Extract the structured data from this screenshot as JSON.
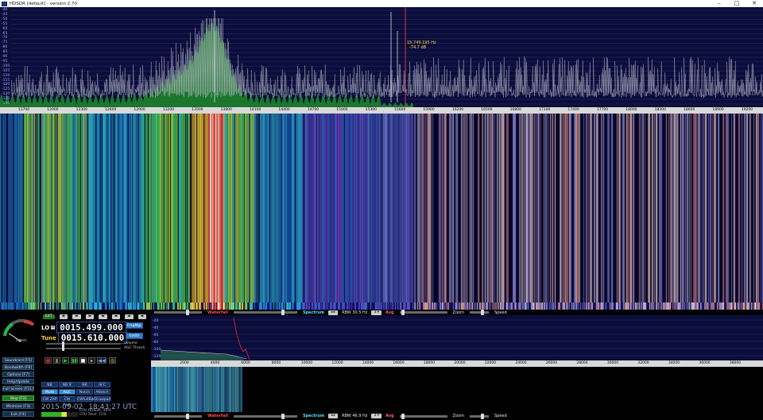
{
  "window": {
    "title": "HDSDR [default] - version 2.70",
    "minimize": "–",
    "maximize": "□",
    "close": "✕"
  },
  "spectrum": {
    "db_labels": [
      "-40",
      "-45",
      "-50",
      "-55",
      "-60",
      "-65",
      "-70",
      "-75",
      "-80",
      "-85",
      "-90",
      "-95",
      "-100",
      "-105",
      "-110",
      "-115",
      "-120",
      "-125",
      "-130",
      "-135",
      "-140"
    ],
    "marker_freq": "15.749.195 Hz",
    "marker_level": "-74.7 dB",
    "axis_ticks": [
      "11700",
      "12000",
      "12300",
      "12600",
      "12900",
      "13200",
      "13500",
      "13800",
      "14100",
      "14400",
      "14700",
      "15000",
      "15300",
      "15600",
      "15900",
      "16200",
      "16500",
      "16800",
      "17100",
      "17400",
      "17700",
      "18000",
      "18300",
      "18600",
      "18900",
      "19200"
    ]
  },
  "strip_top": {
    "waterfall_label": "Waterfall",
    "spectrum_label": "Spectrum",
    "rbw_label": "RBW 30.5 Hz",
    "avg_label": "Avg",
    "zoom_label": "Zoom",
    "speed_label": "Speed"
  },
  "strip_bottom": {
    "waterfall_label": "Waterfall",
    "spectrum_label": "Spectrum",
    "rbw_label": "RBW 46.9 Hz",
    "avg_label": "Avg",
    "zoom_label": "Zoom",
    "speed_label": "Speed"
  },
  "left": {
    "smeter_label": "S-units",
    "buttons": [
      "Soundcard [F5]",
      "Bandwidth [F6]",
      "Options  [F7]",
      "Help/Update [F1]",
      "Full Screen [F11]",
      "Stop     [F2]",
      "Minimize  [F3]",
      "Exit     [F4]"
    ],
    "lo_label": "LO",
    "lo_sub": "A",
    "lo_freq": "0015.499.000",
    "tune_label": "Tune",
    "tune_freq": "0015.610.000",
    "freqmgr": "FreqMgr",
    "extio": "ExtIO",
    "volume": "Volume",
    "agc_thresh": "AGC Thresh.",
    "mode_row1": [
      "NB",
      "NB IF",
      "NR",
      "AFC"
    ],
    "mode_row2": [
      "Mute",
      "AGC Fast",
      "Notch",
      "ANotch"
    ],
    "mode_row3": [
      "CW ZAP",
      "CW Peak",
      "CWfullBw",
      "Drawpad"
    ],
    "date": "2015-09-02",
    "time": "18:43:27 UTC",
    "cpu1_label": "CPU",
    "cpu1_value": "HDSDR: 44%",
    "cpu2_label": "CPU",
    "cpu2_value": "Total: 72%"
  },
  "audio": {
    "db_labels": [
      "-20",
      "-40",
      "-60",
      "-80",
      "-100",
      "-120"
    ],
    "axis_ticks": [
      "2000",
      "4000",
      "6000",
      "8000",
      "10000",
      "12000",
      "14000",
      "16000",
      "18000",
      "20000",
      "22000",
      "24000",
      "26000",
      "28000",
      "30000",
      "32000",
      "34000",
      "36000",
      "38000"
    ]
  },
  "colors": {
    "background": "#0b0d3a",
    "spectrum_trace": "#b8bcc8",
    "spectrum_fill": "#1f8a2a",
    "marker_line": "#d23b3b",
    "accent": "#3a8fd8"
  },
  "icons": {
    "record": "record-icon",
    "play": "play-icon",
    "pause": "pause-icon",
    "stop": "stop-icon",
    "rewind": "rewind-icon",
    "loop": "loop-icon"
  }
}
